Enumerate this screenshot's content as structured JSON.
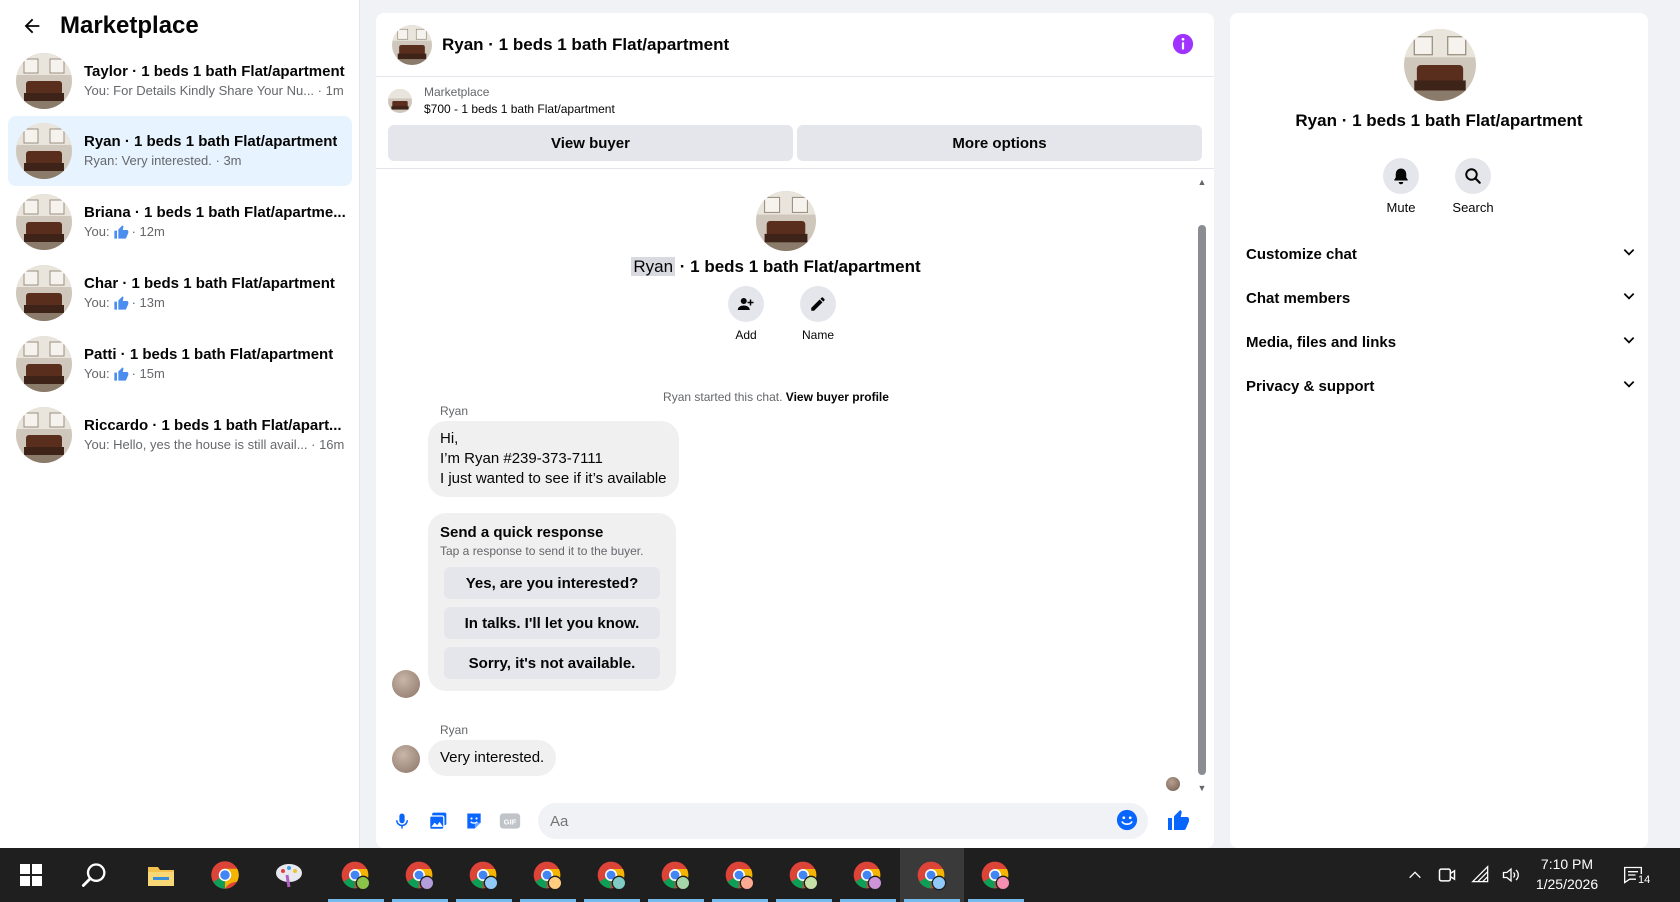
{
  "sidebar": {
    "title": "Marketplace",
    "conversations": [
      {
        "title": "Taylor · 1 beds 1 bath Flat/apartment",
        "sub": "You: For Details Kindly Share Your Nu... · 1m",
        "thumb": false
      },
      {
        "title": "Ryan · 1 beds 1 bath Flat/apartment",
        "sub": "Ryan: Very interested. · 3m",
        "thumb": false
      },
      {
        "title": "Briana · 1 beds 1 bath Flat/apartme...",
        "sub_prefix": "You:",
        "sub_suffix": "· 12m",
        "thumb": true
      },
      {
        "title": "Char · 1 beds 1 bath Flat/apartment",
        "sub_prefix": "You:",
        "sub_suffix": "· 13m",
        "thumb": true
      },
      {
        "title": "Patti · 1 beds 1 bath Flat/apartment",
        "sub_prefix": "You:",
        "sub_suffix": "· 15m",
        "thumb": true
      },
      {
        "title": "Riccardo · 1 beds 1 bath Flat/apart...",
        "sub": "You: Hello, yes the house is still avail... · 16m",
        "thumb": false
      }
    ]
  },
  "chat": {
    "header_title": "Ryan · 1 beds 1 bath Flat/apartment",
    "listing_kicker": "Marketplace",
    "listing_price": "$700 - 1 beds 1 bath Flat/apartment",
    "view_buyer": "View buyer",
    "more_options": "More options",
    "intro_name": "Ryan",
    "intro_rest": " · 1 beds 1 bath Flat/apartment",
    "add_label": "Add",
    "name_label": "Name",
    "started_text": "Ryan started this chat. ",
    "started_link": "View buyer profile",
    "sender1": "Ryan",
    "msg1_l1": "Hi,",
    "msg1_l2": "I’m Ryan #239-373-7111",
    "msg1_l3": "I just wanted to see if it’s available",
    "quick_title": "Send a quick response",
    "quick_sub": "Tap a response to send it to the buyer.",
    "quick_1": "Yes, are you interested?",
    "quick_2": "In talks. I'll let you know.",
    "quick_3": "Sorry, it's not available.",
    "sender2": "Ryan",
    "msg2": "Very interested.",
    "input_placeholder": "Aa"
  },
  "right_panel": {
    "title": "Ryan · 1 beds 1 bath Flat/apartment",
    "mute": "Mute",
    "search": "Search",
    "sections": [
      "Customize chat",
      "Chat members",
      "Media, files and links",
      "Privacy & support"
    ]
  },
  "taskbar": {
    "time": "7:10 PM",
    "date": "1/25/2026",
    "notifications": "14"
  },
  "colors": {
    "accent": "#0866ff",
    "active_conv": "#e7f3ff",
    "info": "#a033ff"
  }
}
